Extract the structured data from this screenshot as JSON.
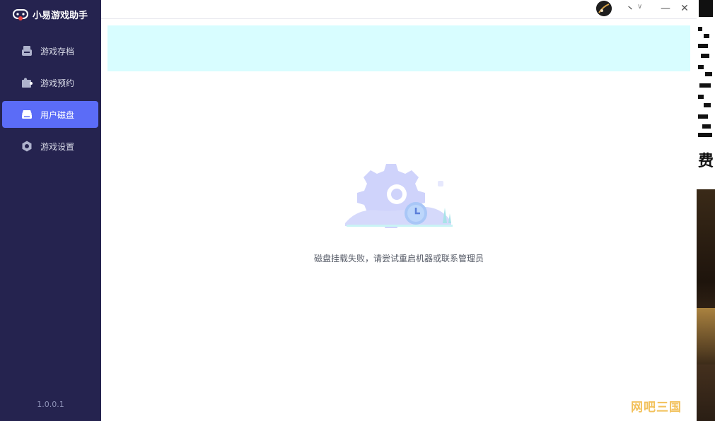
{
  "app": {
    "title": "小易游戏助手",
    "version": "1.0.0.1"
  },
  "sidebar": {
    "items": [
      {
        "label": "游戏存档",
        "icon": "save-archive-icon",
        "active": false
      },
      {
        "label": "游戏预约",
        "icon": "puzzle-icon",
        "active": false
      },
      {
        "label": "用户磁盘",
        "icon": "disk-icon",
        "active": true
      },
      {
        "label": "游戏设置",
        "icon": "gear-icon",
        "active": false
      }
    ]
  },
  "titlebar": {
    "user_name": "丶",
    "caret": "∨",
    "minimize": "—",
    "close": "✕"
  },
  "main": {
    "empty_message": "磁盘挂载失败，请尝试重启机器或联系管理员"
  },
  "overlay": {
    "watermark": "网吧三国",
    "ad_text": "费"
  },
  "colors": {
    "sidebar_bg": "#25234f",
    "accent": "#5b6cf7",
    "banner_bg": "#d8fdff"
  }
}
